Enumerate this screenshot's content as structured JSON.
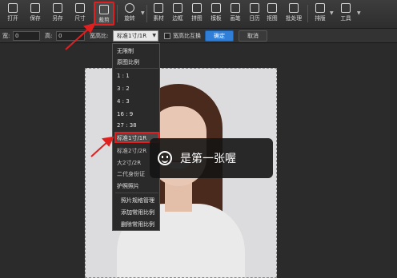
{
  "toolbar": {
    "items": [
      {
        "label": "打开",
        "icon": "folder-open-icon"
      },
      {
        "label": "保存",
        "icon": "save-icon"
      },
      {
        "label": "另存",
        "icon": "save-as-icon"
      },
      {
        "label": "尺寸",
        "icon": "resize-icon"
      },
      {
        "label": "裁剪",
        "icon": "crop-icon",
        "active": true
      },
      {
        "label": "旋转",
        "icon": "rotate-icon"
      },
      {
        "label": "素材",
        "icon": "add-material-icon"
      },
      {
        "label": "边框",
        "icon": "frame-icon"
      },
      {
        "label": "拼图",
        "icon": "collage-icon"
      },
      {
        "label": "模板",
        "icon": "template-icon"
      },
      {
        "label": "画笔",
        "icon": "brush-icon"
      },
      {
        "label": "日历",
        "icon": "calendar-icon"
      },
      {
        "label": "抠图",
        "icon": "cutout-icon"
      },
      {
        "label": "批处理",
        "icon": "batch-icon"
      },
      {
        "label": "排版",
        "icon": "layout-icon"
      },
      {
        "label": "工具",
        "icon": "tools-icon"
      }
    ]
  },
  "optbar": {
    "width_label": "宽:",
    "width_value": "0",
    "height_label": "高:",
    "height_value": "0",
    "ratio_label": "宽高比:",
    "ratio_value": "标准1寸/1R",
    "swap_label": "宽高比互换",
    "ok": "确定",
    "cancel": "取消"
  },
  "dropdown": {
    "items": [
      "无限制",
      "原图比例",
      "1 : 1",
      "3 : 2",
      "4 : 3",
      "16 : 9",
      "27 : 38",
      "标准1寸/1R",
      "标准2寸/2R",
      "大2寸/2R",
      "二代身份证",
      "护照照片",
      "照片规格管理",
      "添加常用比例",
      "删除常用比例"
    ]
  },
  "toast": {
    "text": "是第一张喔"
  },
  "colors": {
    "highlight": "#e02020",
    "accent": "#2f7fd8"
  }
}
